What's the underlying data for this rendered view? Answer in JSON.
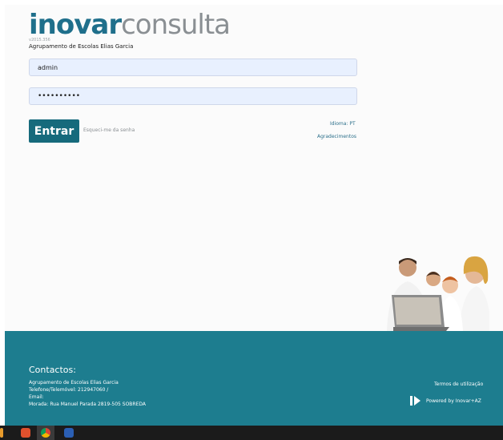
{
  "brand": {
    "part1": "inovar",
    "part2": "consulta",
    "version": "v2015.356"
  },
  "school_name": "Agrupamento de Escolas Elias Garcia",
  "login": {
    "username_value": "admin",
    "password_value": "••••••••••",
    "enter_label": "Entrar",
    "forgot_label": "Esqueci-me da senha",
    "language_label": "Idioma: PT",
    "thanks_label": "Agradecimentos"
  },
  "footer": {
    "contacts_title": "Contactos:",
    "lines": [
      "Agrupamento de Escolas Elias Garcia",
      "Telefone/Telemóvel: 212947060 /",
      "Email:",
      "Morada: Rua Manuel Parada 2819-505 SOBREDA"
    ],
    "terms_label": "Termos de utilização",
    "powered_label": "Powered by Inovar+AZ"
  },
  "taskbar": {
    "icons": [
      "brave-browser-icon",
      "chrome-browser-icon",
      "word-icon"
    ]
  },
  "colors": {
    "brand_teal": "#166a7c",
    "footer": "#1d7d8f",
    "input_bg": "#e8f0fe"
  }
}
